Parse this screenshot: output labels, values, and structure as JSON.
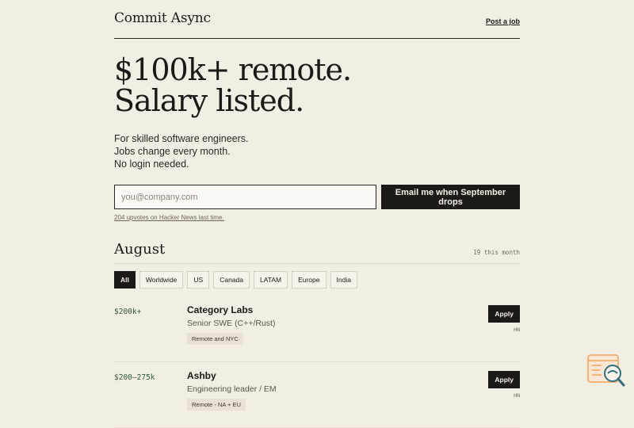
{
  "header": {
    "brand": "Commit Async",
    "post_link": "Post a job"
  },
  "hero": {
    "title_line1": "$100k+ remote.",
    "title_line2": "Salary listed.",
    "sub1": "For skilled software engineers.",
    "sub2": "Jobs change every month.",
    "sub3": "No login needed."
  },
  "signup": {
    "placeholder": "you@company.com",
    "button": "Email me when September drops",
    "hn_note": "204 upvotes on Hacker News last time."
  },
  "listing": {
    "month": "August",
    "count": "19 this month"
  },
  "filters": [
    "All",
    "Worldwide",
    "US",
    "Canada",
    "LATAM",
    "Europe",
    "India"
  ],
  "jobs": [
    {
      "salary": "$200k+",
      "company": "Category Labs",
      "role": "Senior SWE (C++/Rust)",
      "tag": "Remote and NYC",
      "apply": "Apply",
      "source": "HN"
    },
    {
      "salary": "$200–275k",
      "company": "Ashby",
      "role": "Engineering leader / EM",
      "tag": "Remote - NA + EU",
      "apply": "Apply",
      "source": "HN"
    }
  ],
  "colors": {
    "background": "#f3eee4",
    "ink": "#1c1a17",
    "salary": "#2f5a3a",
    "widget_accent": "#f0a35b"
  },
  "icons": {
    "widget": "search-feedback-icon"
  }
}
